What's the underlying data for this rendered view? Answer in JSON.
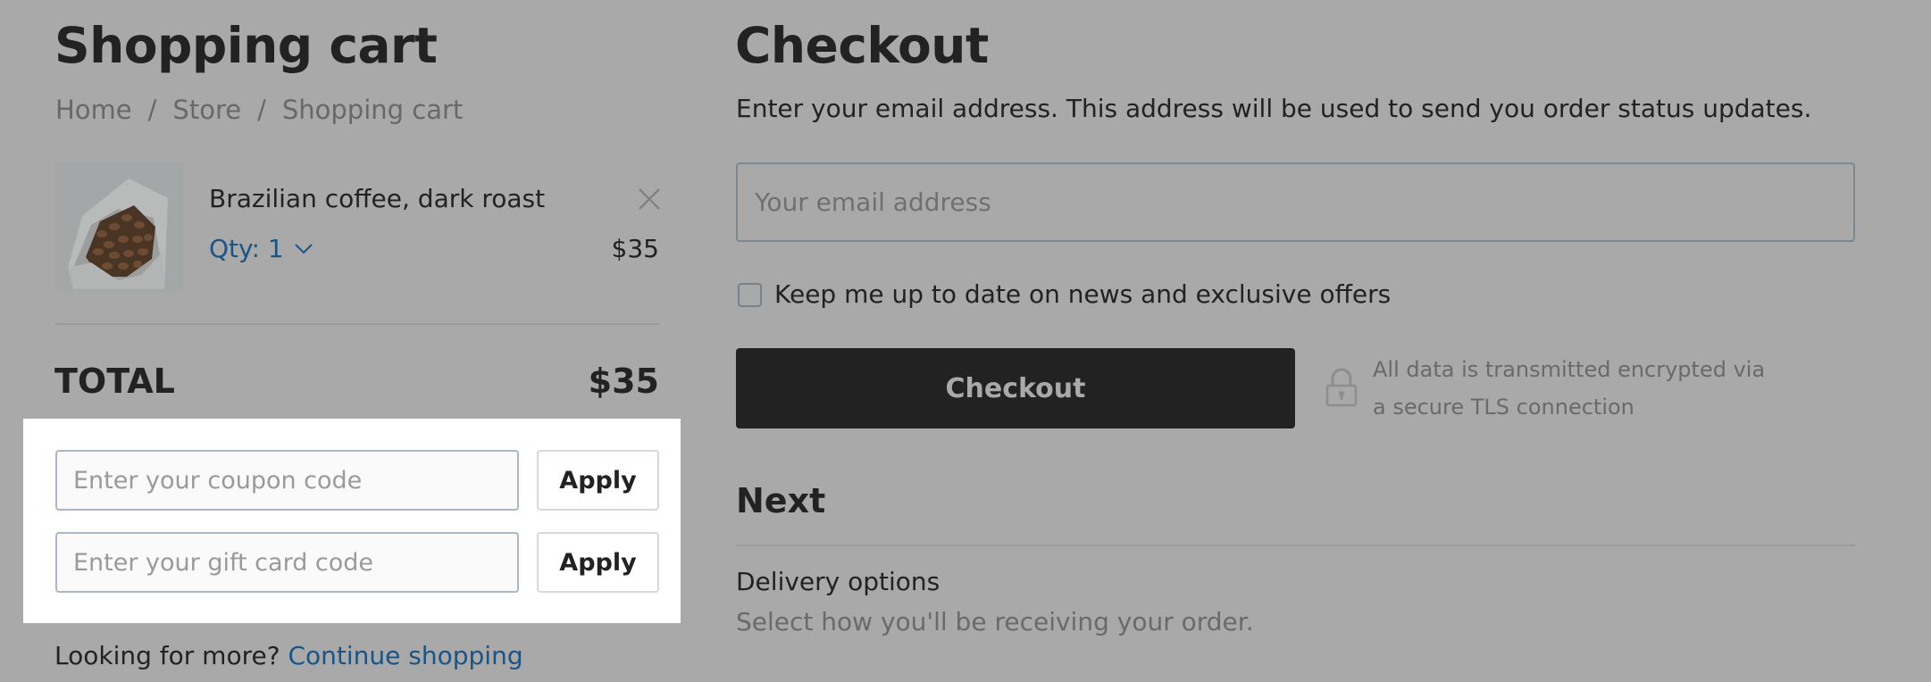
{
  "cart": {
    "title": "Shopping cart",
    "breadcrumb": [
      {
        "label": "Home"
      },
      {
        "label": "Store"
      },
      {
        "label": "Shopping cart"
      }
    ],
    "breadcrumb_separator": "/",
    "item": {
      "name": "Brazilian coffee, dark roast",
      "qty_label": "Qty: 1",
      "price": "$35",
      "image": "coffee-bag-image"
    },
    "total_label": "TOTAL",
    "total_value": "$35",
    "coupon": {
      "placeholder": "Enter your coupon code",
      "value": "",
      "apply_label": "Apply"
    },
    "gift_card": {
      "placeholder": "Enter your gift card code",
      "value": "",
      "apply_label": "Apply"
    },
    "more_text": "Looking for more?",
    "continue_label": "Continue shopping"
  },
  "checkout": {
    "title": "Checkout",
    "description": "Enter your email address. This address will be used to send you order status updates.",
    "email": {
      "placeholder": "Your email address",
      "value": ""
    },
    "newsletter_label": "Keep me up to date on news and exclusive offers",
    "newsletter_checked": false,
    "button_label": "Checkout",
    "secure_line1": "All data is transmitted encrypted via",
    "secure_line2": "a secure TLS connection",
    "next_title": "Next",
    "delivery_title": "Delivery options",
    "delivery_desc": "Select how you'll be receiving your order."
  },
  "colors": {
    "overlay_bg": "#a9a9a9",
    "text": "#222222",
    "muted": "#686868",
    "link": "#1b5486",
    "button_bg": "#222222",
    "highlight_panel": "#ffffff"
  }
}
